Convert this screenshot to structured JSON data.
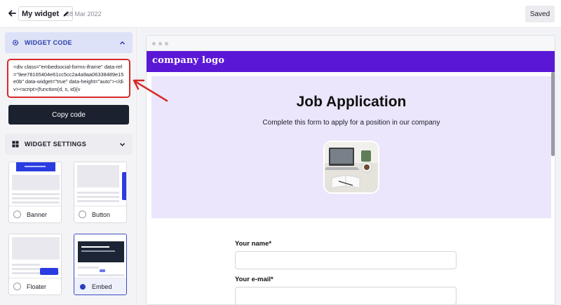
{
  "header": {
    "title": "My widget",
    "date": "28 Mar 2022",
    "saved_label": "Saved"
  },
  "left_panel": {
    "code_section": {
      "heading": "WIDGET CODE",
      "code": "<div class=\"embedsocial-forms-iframe\" data-ref=\"9ee78165404e61cc5cc2a4a9aa06338489e15e0b\" data-widget=\"true\" data-height=\"auto\"></div><script>(function(d, s, id){v",
      "copy_label": "Copy code"
    },
    "settings_section": {
      "heading": "WIDGET SETTINGS",
      "options": [
        {
          "label": "Banner",
          "selected": false
        },
        {
          "label": "Button",
          "selected": false
        },
        {
          "label": "Floater",
          "selected": false
        },
        {
          "label": "Embed",
          "selected": true
        }
      ]
    }
  },
  "preview": {
    "logo": "company logo",
    "title": "Job Application",
    "subtitle": "Complete this form to apply for a position in our company",
    "fields": [
      {
        "label": "Your name*",
        "value": ""
      },
      {
        "label": "Your e-mail*",
        "value": ""
      }
    ]
  },
  "colors": {
    "brand_purple": "#5b17d6",
    "accent_blue": "#2c3ea8",
    "annotation_red": "#d42b2b",
    "dark_button": "#1c2130"
  },
  "icons": [
    "back-arrow-icon",
    "pencil-icon",
    "gear-icon",
    "chevron-up-icon",
    "grid-icon",
    "chevron-down-icon"
  ]
}
